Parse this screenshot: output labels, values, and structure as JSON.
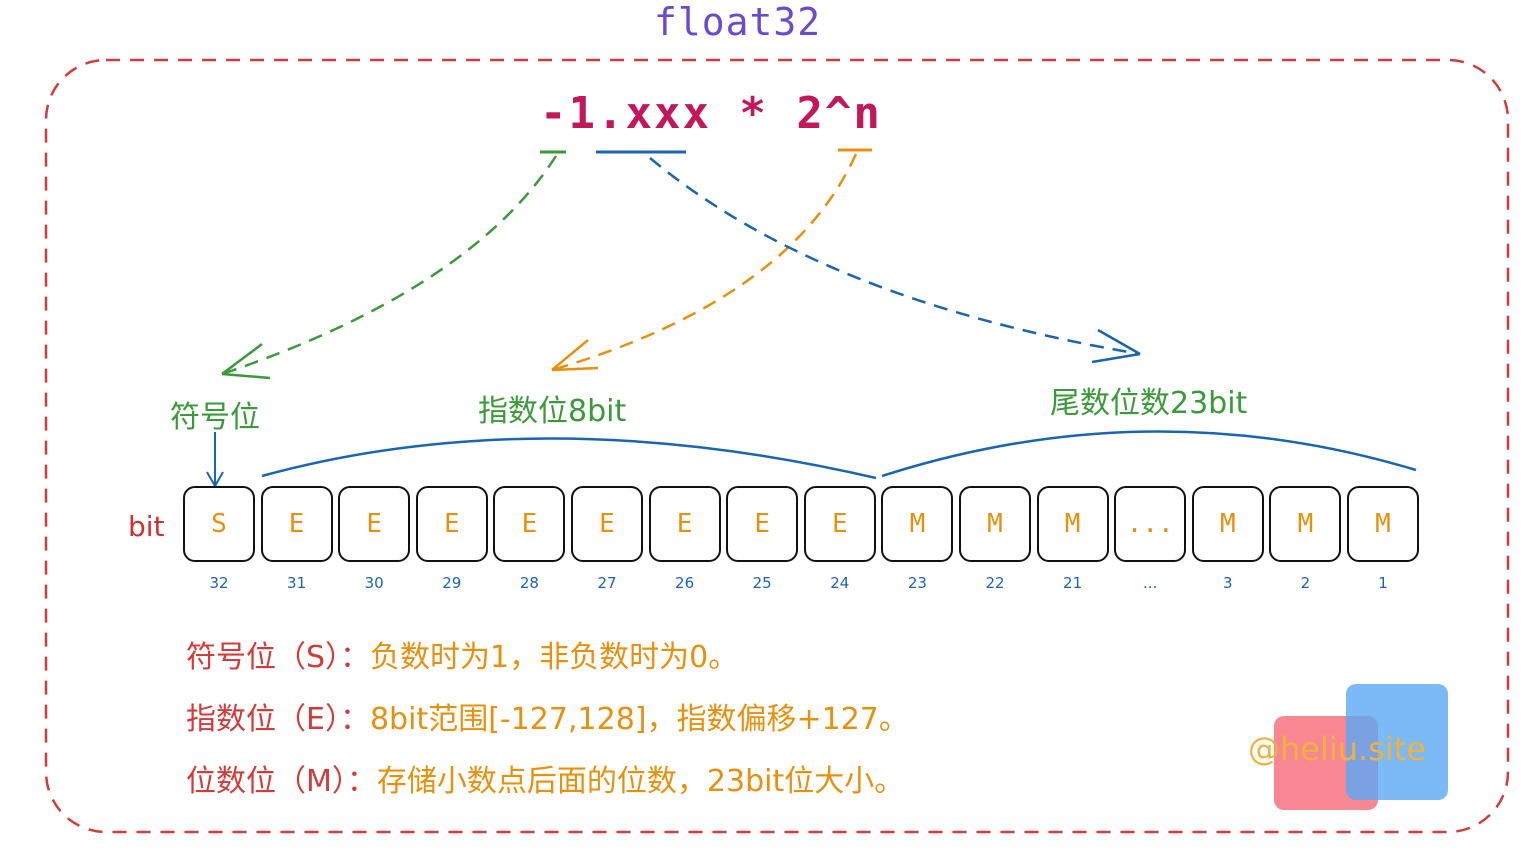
{
  "title": "float32",
  "formula": "-1.xxx * 2^n",
  "labels": {
    "sign": "符号位",
    "exponent": "指数位8bit",
    "mantissa": "尾数位数23bit",
    "bit": "bit"
  },
  "cells": [
    "S",
    "E",
    "E",
    "E",
    "E",
    "E",
    "E",
    "E",
    "E",
    "M",
    "M",
    "M",
    "...",
    "M",
    "M",
    "M"
  ],
  "bit_numbers": [
    "32",
    "31",
    "30",
    "29",
    "28",
    "27",
    "26",
    "25",
    "24",
    "23",
    "22",
    "21",
    "...",
    "3",
    "2",
    "1"
  ],
  "notes": [
    {
      "key": "符号位（S）：",
      "value": "负数时为1，非负数时为0。"
    },
    {
      "key": "指数位（E）：",
      "value": "8bit范围[-127,128]，指数偏移+127。"
    },
    {
      "key": "位数位（M）：",
      "value": "存储小数点后面的位数，23bit位大小。"
    }
  ],
  "watermark": "@heliu.site",
  "colors": {
    "frame": "#d33b3b",
    "sign_arrow": "#3a9a3a",
    "exponent_arrow": "#e8900c",
    "mantissa_arrow": "#1a64b4",
    "cell_text": "#e8900c"
  }
}
